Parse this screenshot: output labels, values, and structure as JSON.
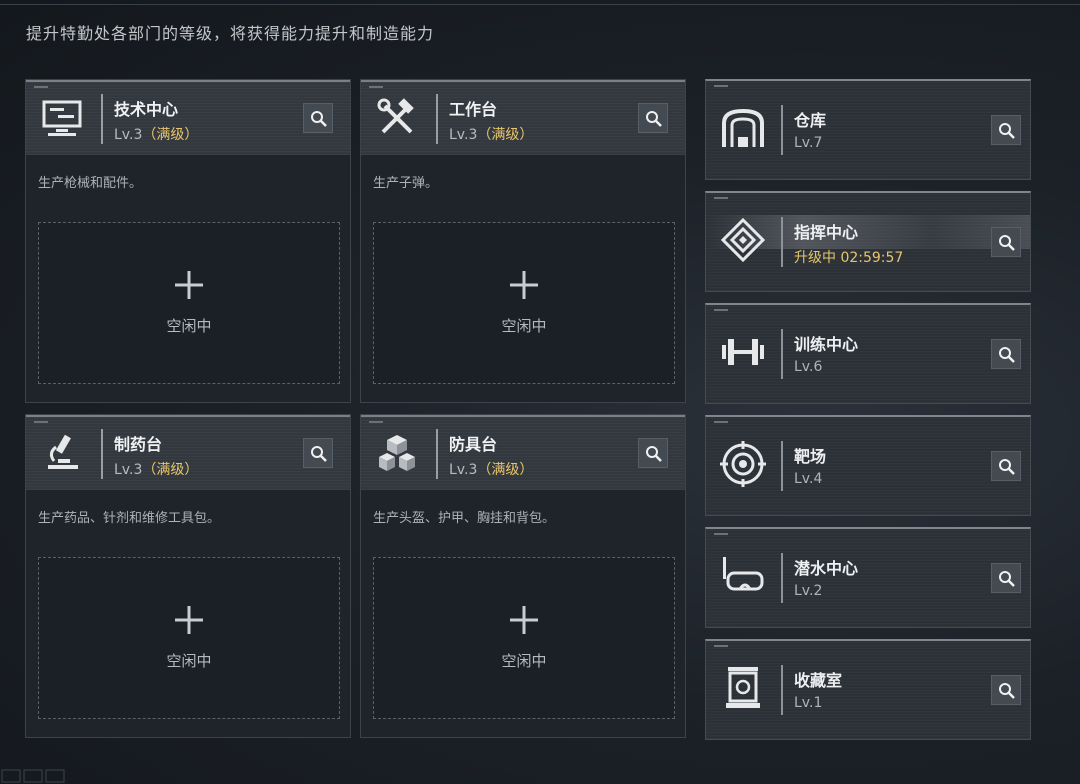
{
  "header": {
    "subtitle": "提升特勤处各部门的等级，将获得能力提升和制造能力"
  },
  "common": {
    "idle_label": "空闲中"
  },
  "departments": [
    {
      "name": "技术中心",
      "level": "Lv.3",
      "max_tag": "（满级）",
      "description": "生产枪械和配件。",
      "icon": "monitor-icon"
    },
    {
      "name": "工作台",
      "level": "Lv.3",
      "max_tag": "（满级）",
      "description": "生产子弹。",
      "icon": "hammer-wrench-icon"
    },
    {
      "name": "制药台",
      "level": "Lv.3",
      "max_tag": "（满级）",
      "description": "生产药品、针剂和维修工具包。",
      "icon": "microscope-icon"
    },
    {
      "name": "防具台",
      "level": "Lv.3",
      "max_tag": "（满级）",
      "description": "生产头盔、护甲、胸挂和背包。",
      "icon": "cubes-icon"
    }
  ],
  "facilities": [
    {
      "name": "仓库",
      "status": "Lv.7",
      "icon": "warehouse-icon",
      "upgrading": false
    },
    {
      "name": "指挥中心",
      "status": "升级中 02:59:57",
      "icon": "command-emblem-icon",
      "upgrading": true
    },
    {
      "name": "训练中心",
      "status": "Lv.6",
      "icon": "dumbbell-icon",
      "upgrading": false
    },
    {
      "name": "靶场",
      "status": "Lv.4",
      "icon": "target-icon",
      "upgrading": false
    },
    {
      "name": "潜水中心",
      "status": "Lv.2",
      "icon": "diving-mask-icon",
      "upgrading": false
    },
    {
      "name": "收藏室",
      "status": "Lv.1",
      "icon": "display-case-icon",
      "upgrading": false
    }
  ],
  "colors": {
    "accent_gold": "#e8c56a",
    "panel": "#1f242a",
    "header": "#33383f"
  }
}
